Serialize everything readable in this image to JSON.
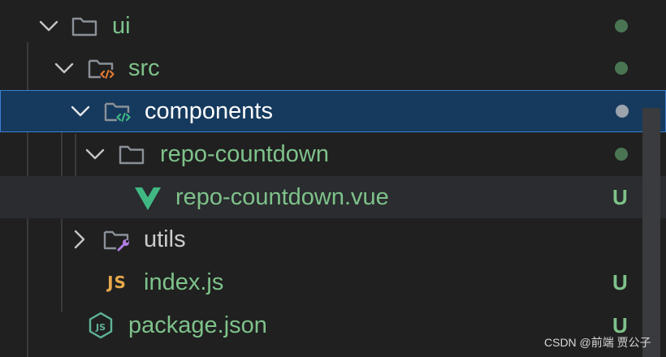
{
  "explorer": {
    "items": [
      {
        "label": "ui",
        "kind": "folder",
        "expanded": true,
        "icon": "folder-icon",
        "label_color": "#7ec28a",
        "status_dot_color": "#4a7553"
      },
      {
        "label": "src",
        "kind": "folder",
        "expanded": true,
        "icon": "folder-src-icon",
        "label_color": "#7ec28a",
        "status_dot_color": "#4a7553"
      },
      {
        "label": "components",
        "kind": "folder",
        "expanded": true,
        "selected": true,
        "icon": "folder-components-icon",
        "label_color": "#ffffff",
        "status_dot_color": "#9ca3ad"
      },
      {
        "label": "repo-countdown",
        "kind": "folder",
        "expanded": true,
        "icon": "folder-icon",
        "label_color": "#7ec28a",
        "status_dot_color": "#4a7553"
      },
      {
        "label": "repo-countdown.vue",
        "kind": "file",
        "hovered": true,
        "icon": "vue-icon",
        "label_color": "#7ec28a",
        "status": "U"
      },
      {
        "label": "utils",
        "kind": "folder",
        "expanded": false,
        "icon": "folder-utils-icon",
        "label_color": "#cccccc"
      },
      {
        "label": "index.js",
        "kind": "file",
        "icon": "js-icon",
        "icon_text": "JS",
        "label_color": "#7ec28a",
        "status": "U"
      },
      {
        "label": "package.json",
        "kind": "file",
        "icon": "nodejs-icon",
        "label_color": "#7ec28a",
        "status": "U"
      }
    ]
  },
  "colors": {
    "background": "#202020",
    "selection_bg": "#163a5e",
    "selection_border": "#3b7fd4",
    "untracked": "#7ec28a",
    "folder_icon": "#8b9199",
    "vue_green": "#41b883",
    "js_yellow": "#e5a84b",
    "node_green": "#5fb39a",
    "utils_wrench": "#b07ee5",
    "src_orange": "#e37933"
  },
  "watermark": "CSDN @前端 贾公子"
}
